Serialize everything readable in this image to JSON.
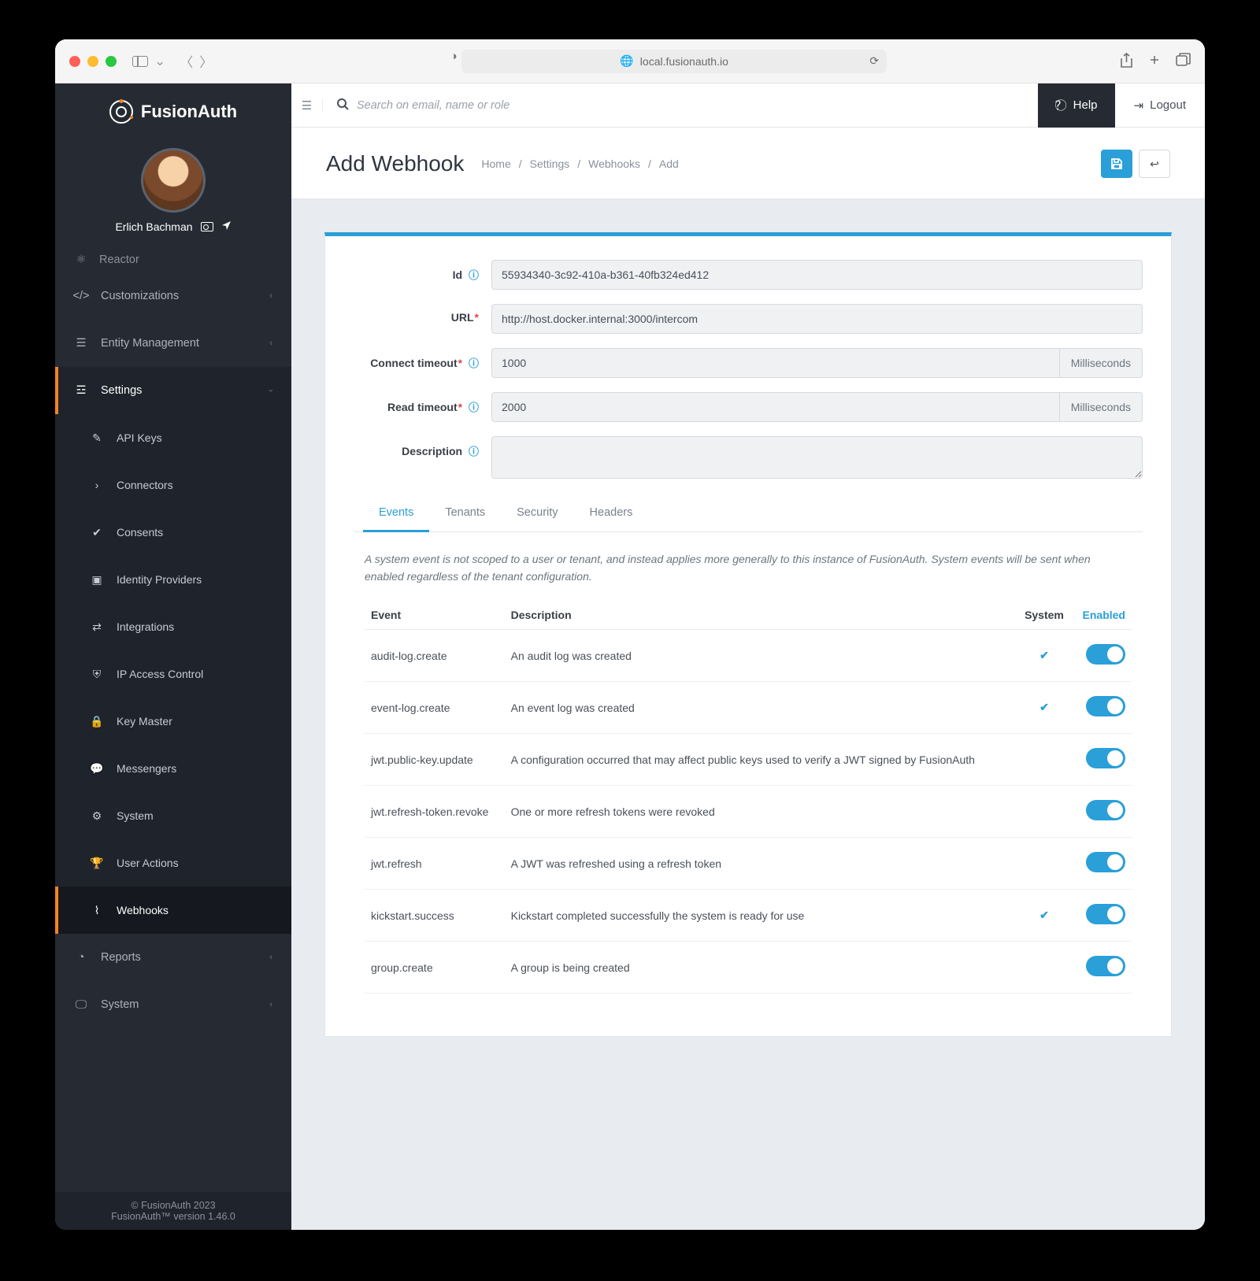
{
  "browser": {
    "address": "local.fusionauth.io"
  },
  "brand": {
    "name": "FusionAuth"
  },
  "user": {
    "name": "Erlich Bachman"
  },
  "nav": {
    "clipped": "Reactor",
    "items": [
      {
        "label": "Customizations",
        "icon": "code"
      },
      {
        "label": "Entity Management",
        "icon": "server"
      },
      {
        "label": "Settings",
        "icon": "sliders",
        "active": true
      },
      {
        "label": "Reports",
        "icon": "pie"
      },
      {
        "label": "System",
        "icon": "monitor"
      }
    ],
    "settings_sub": [
      {
        "label": "API Keys",
        "icon": "key"
      },
      {
        "label": "Connectors",
        "icon": "chevr"
      },
      {
        "label": "Consents",
        "icon": "check"
      },
      {
        "label": "Identity Providers",
        "icon": "idcard"
      },
      {
        "label": "Integrations",
        "icon": "swap"
      },
      {
        "label": "IP Access Control",
        "icon": "shield"
      },
      {
        "label": "Key Master",
        "icon": "lock"
      },
      {
        "label": "Messengers",
        "icon": "chat"
      },
      {
        "label": "System",
        "icon": "gear"
      },
      {
        "label": "User Actions",
        "icon": "trophy"
      },
      {
        "label": "Webhooks",
        "icon": "rss",
        "selected": true
      }
    ]
  },
  "topbar": {
    "search_placeholder": "Search on email, name or role",
    "help": "Help",
    "logout": "Logout"
  },
  "page": {
    "title": "Add Webhook",
    "crumbs": [
      "Home",
      "Settings",
      "Webhooks",
      "Add"
    ]
  },
  "form": {
    "id_label": "Id",
    "id_value": "55934340-3c92-410a-b361-40fb324ed412",
    "url_label": "URL",
    "url_value": "http://host.docker.internal:3000/intercom",
    "connect_label": "Connect timeout",
    "connect_value": "1000",
    "read_label": "Read timeout",
    "read_value": "2000",
    "desc_label": "Description",
    "unit": "Milliseconds"
  },
  "tabs": [
    "Events",
    "Tenants",
    "Security",
    "Headers"
  ],
  "events": {
    "note": "A system event is not scoped to a user or tenant, and instead applies more generally to this instance of FusionAuth. System events will be sent when enabled regardless of the tenant configuration.",
    "cols": {
      "event": "Event",
      "desc": "Description",
      "system": "System",
      "enabled": "Enabled"
    },
    "rows": [
      {
        "event": "audit-log.create",
        "desc": "An audit log was created",
        "system": true
      },
      {
        "event": "event-log.create",
        "desc": "An event log was created",
        "system": true
      },
      {
        "event": "jwt.public-key.update",
        "desc": "A configuration occurred that may affect public keys used to verify a JWT signed by FusionAuth",
        "system": false
      },
      {
        "event": "jwt.refresh-token.revoke",
        "desc": "One or more refresh tokens were revoked",
        "system": false
      },
      {
        "event": "jwt.refresh",
        "desc": "A JWT was refreshed using a refresh token",
        "system": false
      },
      {
        "event": "kickstart.success",
        "desc": "Kickstart completed successfully the system is ready for use",
        "system": true
      },
      {
        "event": "group.create",
        "desc": "A group is being created",
        "system": false
      }
    ]
  },
  "footer": {
    "line1": "© FusionAuth 2023",
    "line2": "FusionAuth™ version 1.46.0"
  }
}
